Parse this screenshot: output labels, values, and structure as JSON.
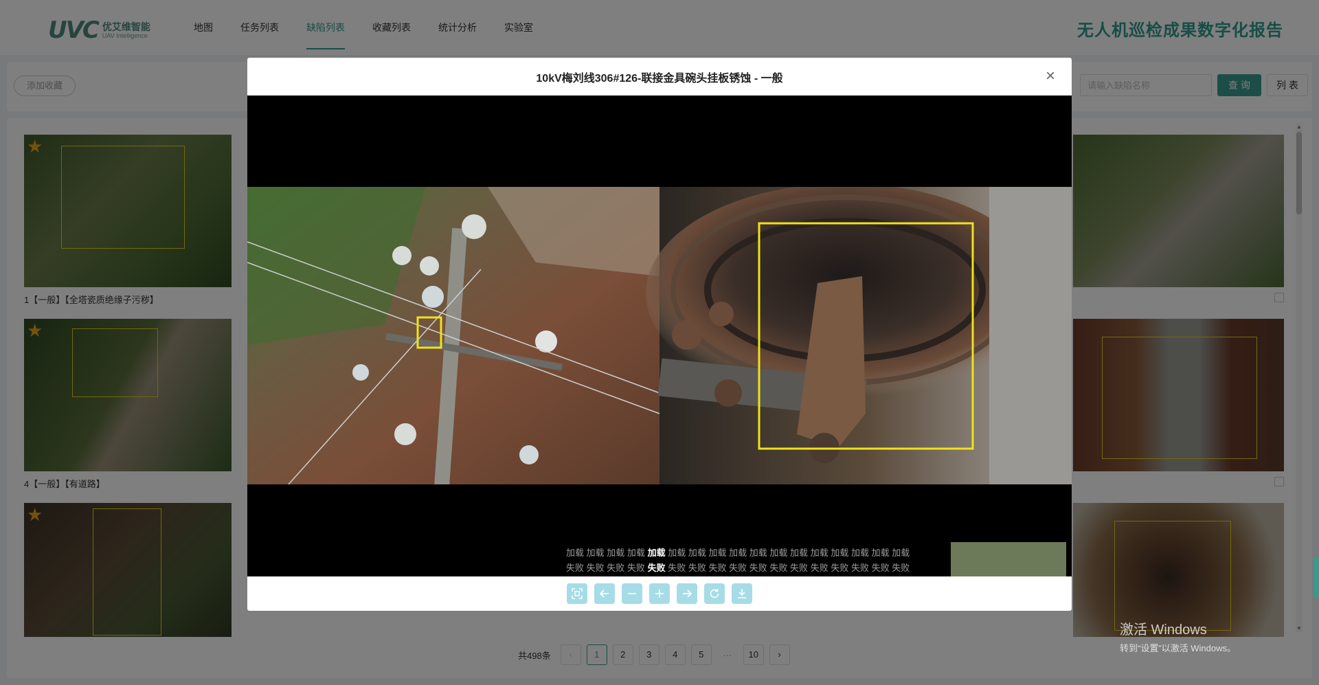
{
  "header": {
    "logo_mark": "UVC",
    "logo_cn": "优艾维智能",
    "logo_en": "UAV Intelligence",
    "report_title": "无人机巡检成果数字化报告",
    "nav": [
      {
        "label": "地图"
      },
      {
        "label": "任务列表"
      },
      {
        "label": "缺陷列表",
        "active": true
      },
      {
        "label": "收藏列表"
      },
      {
        "label": "统计分析"
      },
      {
        "label": "实验室"
      }
    ]
  },
  "toolbar": {
    "fav_label": "添加收藏",
    "search_placeholder": "请输入缺陷名称",
    "query_label": "查 询",
    "list_label": "列 表"
  },
  "cards": [
    {
      "label": "1【一般】【全塔瓷质绝缘子污秽】",
      "starred": true
    },
    {
      "label": "4【一般】【有道路】",
      "starred": true
    },
    {
      "label": "",
      "starred": true
    }
  ],
  "pagination": {
    "total": "共498条",
    "prev": "‹",
    "next": "›",
    "pages": [
      "1",
      "2",
      "3",
      "4",
      "5"
    ],
    "ellipsis": "···",
    "last": "10",
    "active": "1"
  },
  "modal": {
    "title": "10kV梅刘线306#126-联接金具碗头挂板锈蚀 - 一般",
    "close": "×",
    "load_row": [
      "加载",
      "加载",
      "加载",
      "加载",
      "加载",
      "加载",
      "加载",
      "加载",
      "加载",
      "加载",
      "加载",
      "加载",
      "加载",
      "加载",
      "加载",
      "加载",
      "加载"
    ],
    "fail_row": [
      "失败",
      "失败",
      "失败",
      "失败",
      "失败",
      "失败",
      "失败",
      "失败",
      "失败",
      "失败",
      "失败",
      "失败",
      "失败",
      "失败",
      "失败",
      "失败",
      "失败"
    ],
    "highlight_index": 4,
    "tools": [
      {
        "icon": "fullscreen-icon"
      },
      {
        "icon": "arrow-left-icon"
      },
      {
        "icon": "zoom-out-icon"
      },
      {
        "icon": "zoom-in-icon"
      },
      {
        "icon": "arrow-right-icon"
      },
      {
        "icon": "rotate-icon"
      },
      {
        "icon": "download-icon"
      }
    ]
  },
  "watermark": {
    "line1": "激活 Windows",
    "line2": "转到“设置”以激活 Windows。"
  },
  "colors": {
    "brand": "#2e9a8c",
    "box": "#e6d21a",
    "star": "#e8a21a",
    "tool_btn": "#a6dce6"
  }
}
